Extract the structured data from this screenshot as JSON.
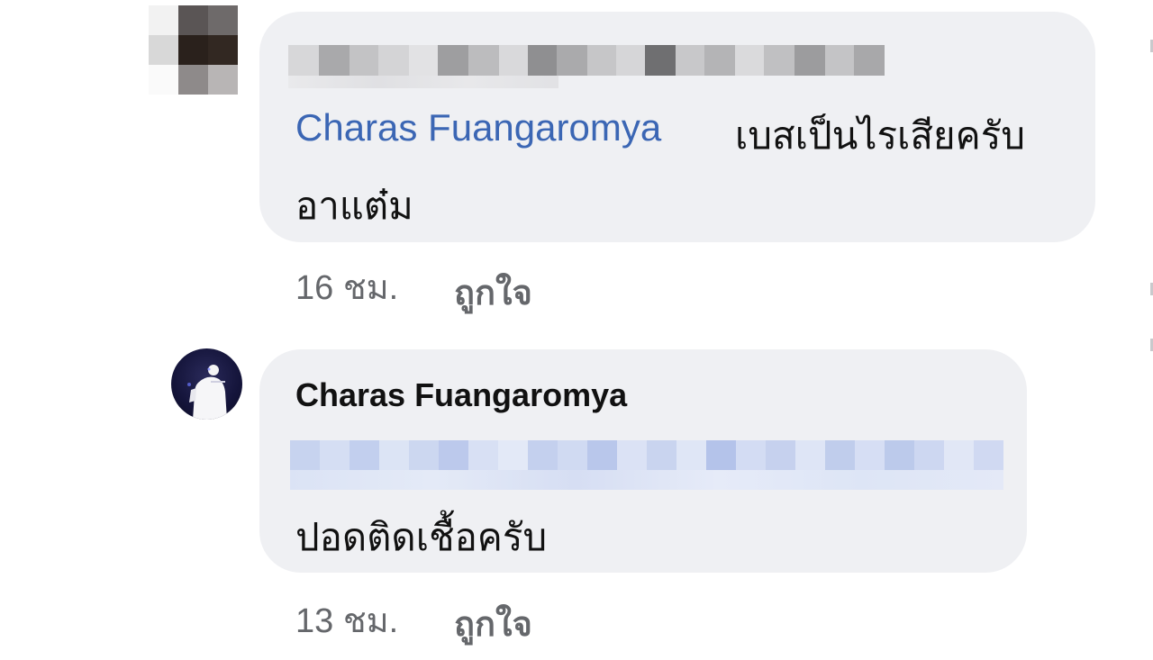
{
  "comments": [
    {
      "mention": "Charas Fuangaromya",
      "text_line1": "เบสเป็นไรเสียครับ",
      "text_line2": "อาแต๋ม",
      "time": "16 ชม.",
      "like_label": "ถูกใจ"
    },
    {
      "author": "Charas Fuangaromya",
      "text": "ปอดติดเชื้อครับ",
      "time": "13 ชม.",
      "like_label": "ถูกใจ"
    }
  ],
  "colors": {
    "bubble": "#eff0f3",
    "mention": "#3b66b4",
    "meta": "#65676b",
    "text": "#111111"
  },
  "icons": [
    "pixelated-avatar-icon",
    "profile-photo-avatar-icon"
  ]
}
